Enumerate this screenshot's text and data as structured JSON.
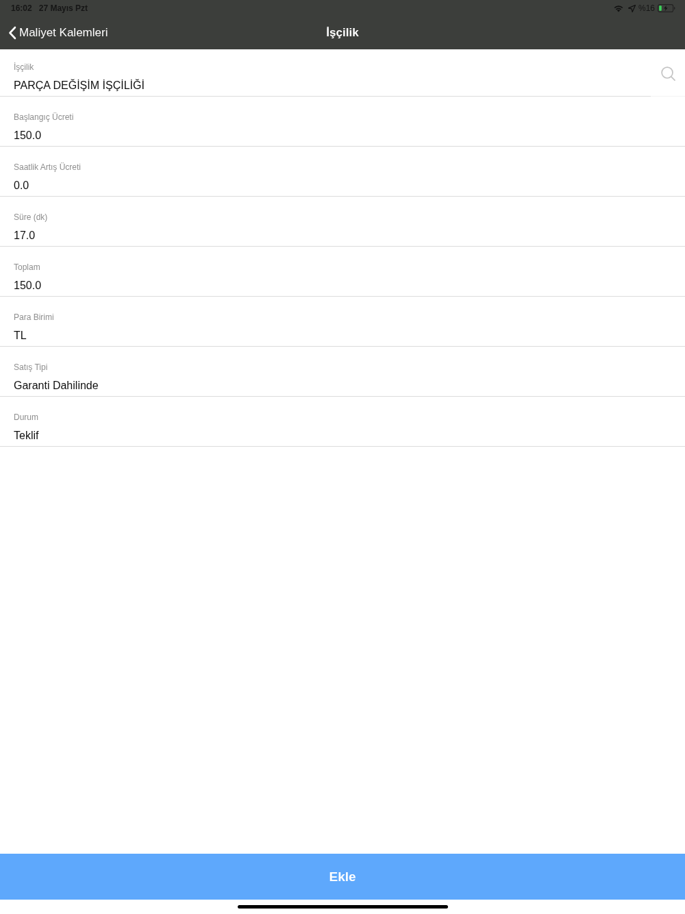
{
  "status_bar": {
    "time": "16:02",
    "date": "27 Mayıs Pzt",
    "battery": "%16"
  },
  "nav": {
    "back": "Maliyet Kalemleri",
    "title": "İşçilik"
  },
  "fields": [
    {
      "kind": "lookup",
      "label": "İşçilik",
      "value": "PARÇA DEĞİŞİM İŞÇİLİĞİ"
    },
    {
      "kind": "text",
      "label": "Başlangıç Ücreti",
      "value": "150.0"
    },
    {
      "kind": "text",
      "label": "Saatlik Artış Ücreti",
      "value": "0.0"
    },
    {
      "kind": "text",
      "label": "Süre (dk)",
      "value": "17.0"
    },
    {
      "kind": "text",
      "label": "Toplam",
      "value": "150.0"
    },
    {
      "kind": "text",
      "label": "Para Birimi",
      "value": "TL"
    },
    {
      "kind": "text",
      "label": "Satış Tipi",
      "value": "Garanti Dahilinde"
    },
    {
      "kind": "text",
      "label": "Durum",
      "value": "Teklif"
    }
  ],
  "button": {
    "label": "Ekle"
  }
}
